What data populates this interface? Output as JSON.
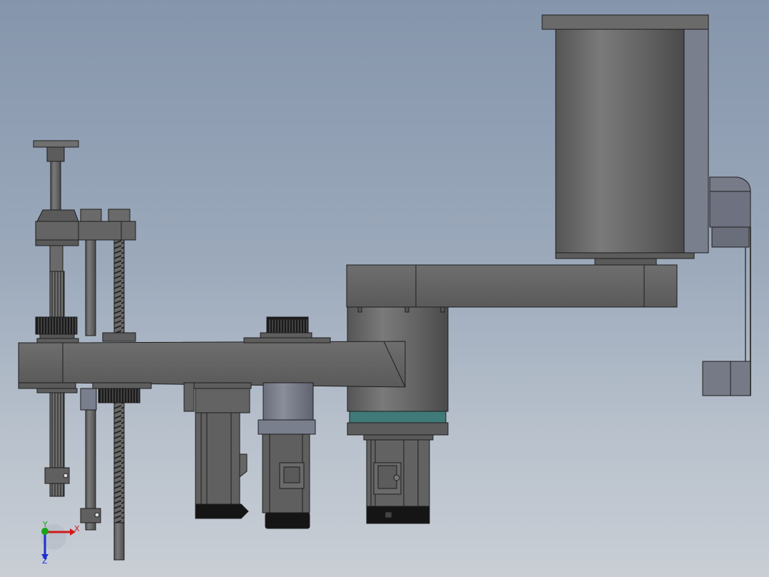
{
  "colors": {
    "background_top": "#8595ab",
    "background_bottom": "#c9ced5",
    "part_body": "#5f5f5f",
    "part_face": "#6b6b6b",
    "part_shadow": "#474747",
    "part_highlight": "#7d7d7d",
    "edge_line": "#1e1e1e",
    "motor_side": "#7a7f8e",
    "seal_ring": "#3f7a78",
    "pulley_dark": "#161616",
    "triad_x": "#d11a1a",
    "triad_y": "#18a318",
    "triad_z": "#1c2fcf"
  },
  "icons": {
    "triad": "coordinate-triad-icon"
  },
  "triad": {
    "x_label": "X",
    "y_label": "Y",
    "z_label": "Z"
  }
}
